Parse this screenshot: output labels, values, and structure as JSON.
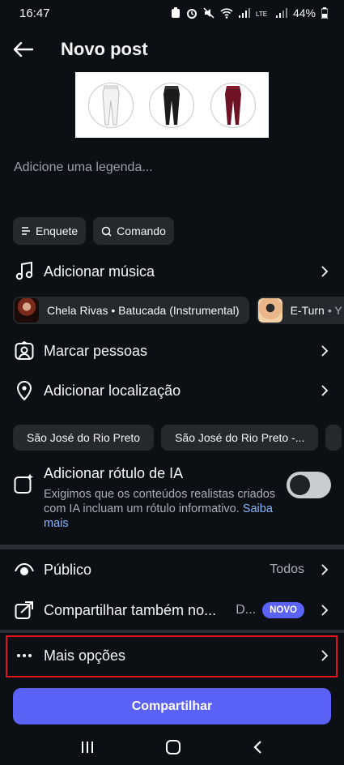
{
  "status": {
    "time": "16:47",
    "battery": "44%"
  },
  "header": {
    "title": "Novo post"
  },
  "caption": {
    "placeholder": "Adicione uma legenda..."
  },
  "chips": [
    {
      "label": "Enquete",
      "icon": "list-icon"
    },
    {
      "label": "Comando",
      "icon": "search-icon"
    }
  ],
  "music": {
    "label": "Adicionar música",
    "suggestions": [
      {
        "text": "Chela Rivas • Batucada (Instrumental)"
      },
      {
        "title": "E-Turn",
        "artist": "• Y"
      }
    ]
  },
  "tag_people": {
    "label": "Marcar pessoas"
  },
  "location": {
    "label": "Adicionar localização",
    "suggestions": [
      "São José do Rio Preto",
      "São José do Rio Preto -..."
    ]
  },
  "ai_label": {
    "title": "Adicionar rótulo de IA",
    "description": "Exigimos que os conteúdos realistas criados com IA incluam um rótulo informativo.",
    "link": "Saiba mais",
    "enabled": false
  },
  "audience": {
    "label": "Público",
    "value": "Todos"
  },
  "share_also": {
    "label": "Compartilhar também no...",
    "value": "D...",
    "badge": "NOVO"
  },
  "more_options": {
    "label": "Mais opções"
  },
  "share_button": {
    "label": "Compartilhar"
  },
  "colors": {
    "background": "#0c1014",
    "accent": "#5b62f8",
    "chip": "#25292e",
    "link": "#8ab4ff",
    "highlight_border": "#e1141b"
  }
}
